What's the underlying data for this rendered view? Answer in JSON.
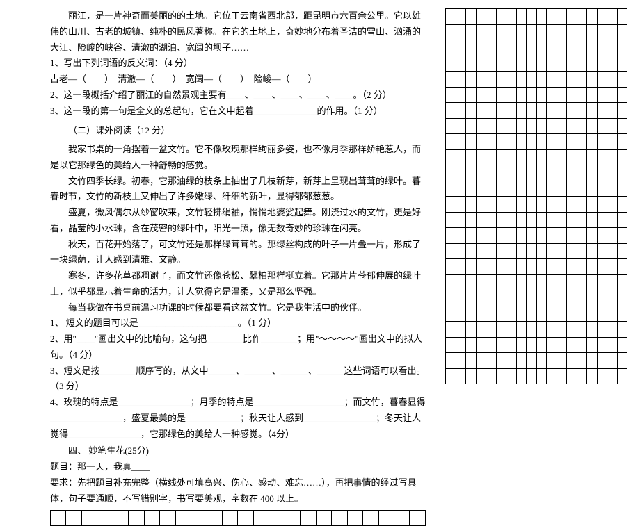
{
  "passage1": {
    "p1": "丽江，是一片神奇而美丽的的土地。它位于云南省西北部，距昆明市六百余公里。它以雄伟的山川、古老的城镇、纯朴的民风著称。在它的土地上，奇妙地分布着圣洁的雪山、汹涌的大江、险峻的峡谷、清澈的湖泊、宽阔的坝子……",
    "q1": "1、写出下列词语的反义词：（4 分）",
    "q1_line": "古老—（　　）　清澈—（　　）　宽阔—（　　）　险峻—（　　）",
    "q2": "2、这一段概括介绍了丽江的自然景观主要有____、____、____、____、____。（2 分）",
    "q3": "3、这一段的第一句是全文的总起句，它在文中起着______________的作用。（1 分）"
  },
  "section2_title": "（二）课外阅读（12 分）",
  "passage2": {
    "p1": "我家书桌的一角摆着一盆文竹。它不像玫瑰那样绚丽多姿，也不像月季那样娇艳惹人，而是以它那绿色的美给人一种舒畅的感觉。",
    "p2": "文竹四季长绿。初春，它那油绿的枝条上抽出了几枝新芽，新芽上呈现出茸茸的绿叶。暮春时节，文竹的新枝上又伸出了许多嫩绿、纤细的新叶，显得郁郁葱葱。",
    "p3": "盛夏，微风偶尔从纱窗吹来，文竹轻拂绢袖，悄悄地婆娑起舞。刚浇过水的文竹，更是好看，晶莹的小水珠，含在茂密的绿叶中，阳光一照，像无数奇妙的珍珠在闪亮。",
    "p4": "秋天，百花开始落了，可文竹还是那样绿茸茸的。那绿丝构成的叶子一片叠一片，形成了一块绿荫，让人感到清雅、文静。",
    "p5": "寒冬，许多花草都凋谢了，而文竹还像苍松、翠柏那样挺立着。它那片片苍郁伸展的绿叶上，似乎都显示着生命的活力，让人觉得它是温柔，又是那么坚强。",
    "p6": "每当我做在书桌前温习功课的时候都要看这盆文竹。它是我生活中的伙伴。"
  },
  "questions2": {
    "q1": "1、 短文的题目可以是______________________。（1 分）",
    "q2": "2、用\"____\"画出文中的比喻句，这句把________比作________；用\"～～～～\"画出文中的拟人句。（4 分）",
    "q3": "3、短文是按________顺序写的，从文中______、______、______、______这些词语可以看出。（3 分）",
    "q4": "4、玫瑰的特点是________________；月季的特点是____________________；而文竹，暮春显得________________，盛夏最美的是____________；秋天让人感到________________；冬天让人觉得________________，它那绿色的美给人一种感觉。（4分）"
  },
  "section4": {
    "title": "四、 妙笔生花(25分)",
    "topic": "题目：那一天，我真____",
    "req": "要求：先把题目补充完整（横线处可填高兴、伤心、感动、难忘……），再把事情的经过写具体，句子要通顺，不写错别字，书写要美观，字数在 400 以上。"
  }
}
